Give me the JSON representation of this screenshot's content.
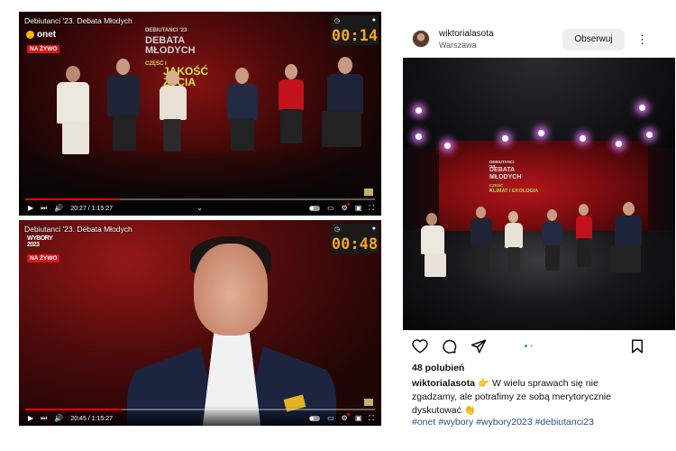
{
  "video_top": {
    "title": "Debiutanci '23. Debata Młodych",
    "channel_logo": "onet",
    "live_badge": "NA ŻYWO",
    "timer": "00:14",
    "screen": {
      "tag": "DEBIUTANCI '23",
      "line1": "DEBATA",
      "line2": "MŁODYCH",
      "part": "CZĘŚĆ I",
      "topic": "JAKOŚĆ ŻYCIA"
    },
    "time_display": "20:27 / 1:15:27",
    "progress": 0.27
  },
  "video_bottom": {
    "title": "Debiutanci '23. Debata Młodych",
    "channel_logo": "WYBORY 2023",
    "live_badge": "NA ŻYWO",
    "timer": "00:48",
    "time_display": "20:45 / 1:15:27",
    "progress": 0.275
  },
  "instagram": {
    "username": "wiktorialasota",
    "location": "Warszawa",
    "follow_label": "Obserwuj",
    "photo_screen": {
      "tag": "DEBIUTANCI '23",
      "line1": "DEBATA",
      "line2": "MŁODYCH",
      "part": "CZĘŚĆ II",
      "topic": "KLIMAT I EKOLOGIA"
    },
    "likes": "48 polubień",
    "caption_user": "wiktorialasota",
    "caption_text": "👉 W wielu sprawach się nie zgadzamy, ale potrafimy ze sobą merytorycznie dyskutować 👏",
    "hashtags": "#onet #wybory #wybory2023 #debiutanci23",
    "carousel_active": 0,
    "carousel_count": 2
  },
  "colors": {
    "live_red": "#d8141b",
    "timer_orange": "#f7a41d",
    "progress_red": "#ff0000",
    "hashtag_blue": "#2a4d8a",
    "topic_green": "#d9ea3a"
  }
}
